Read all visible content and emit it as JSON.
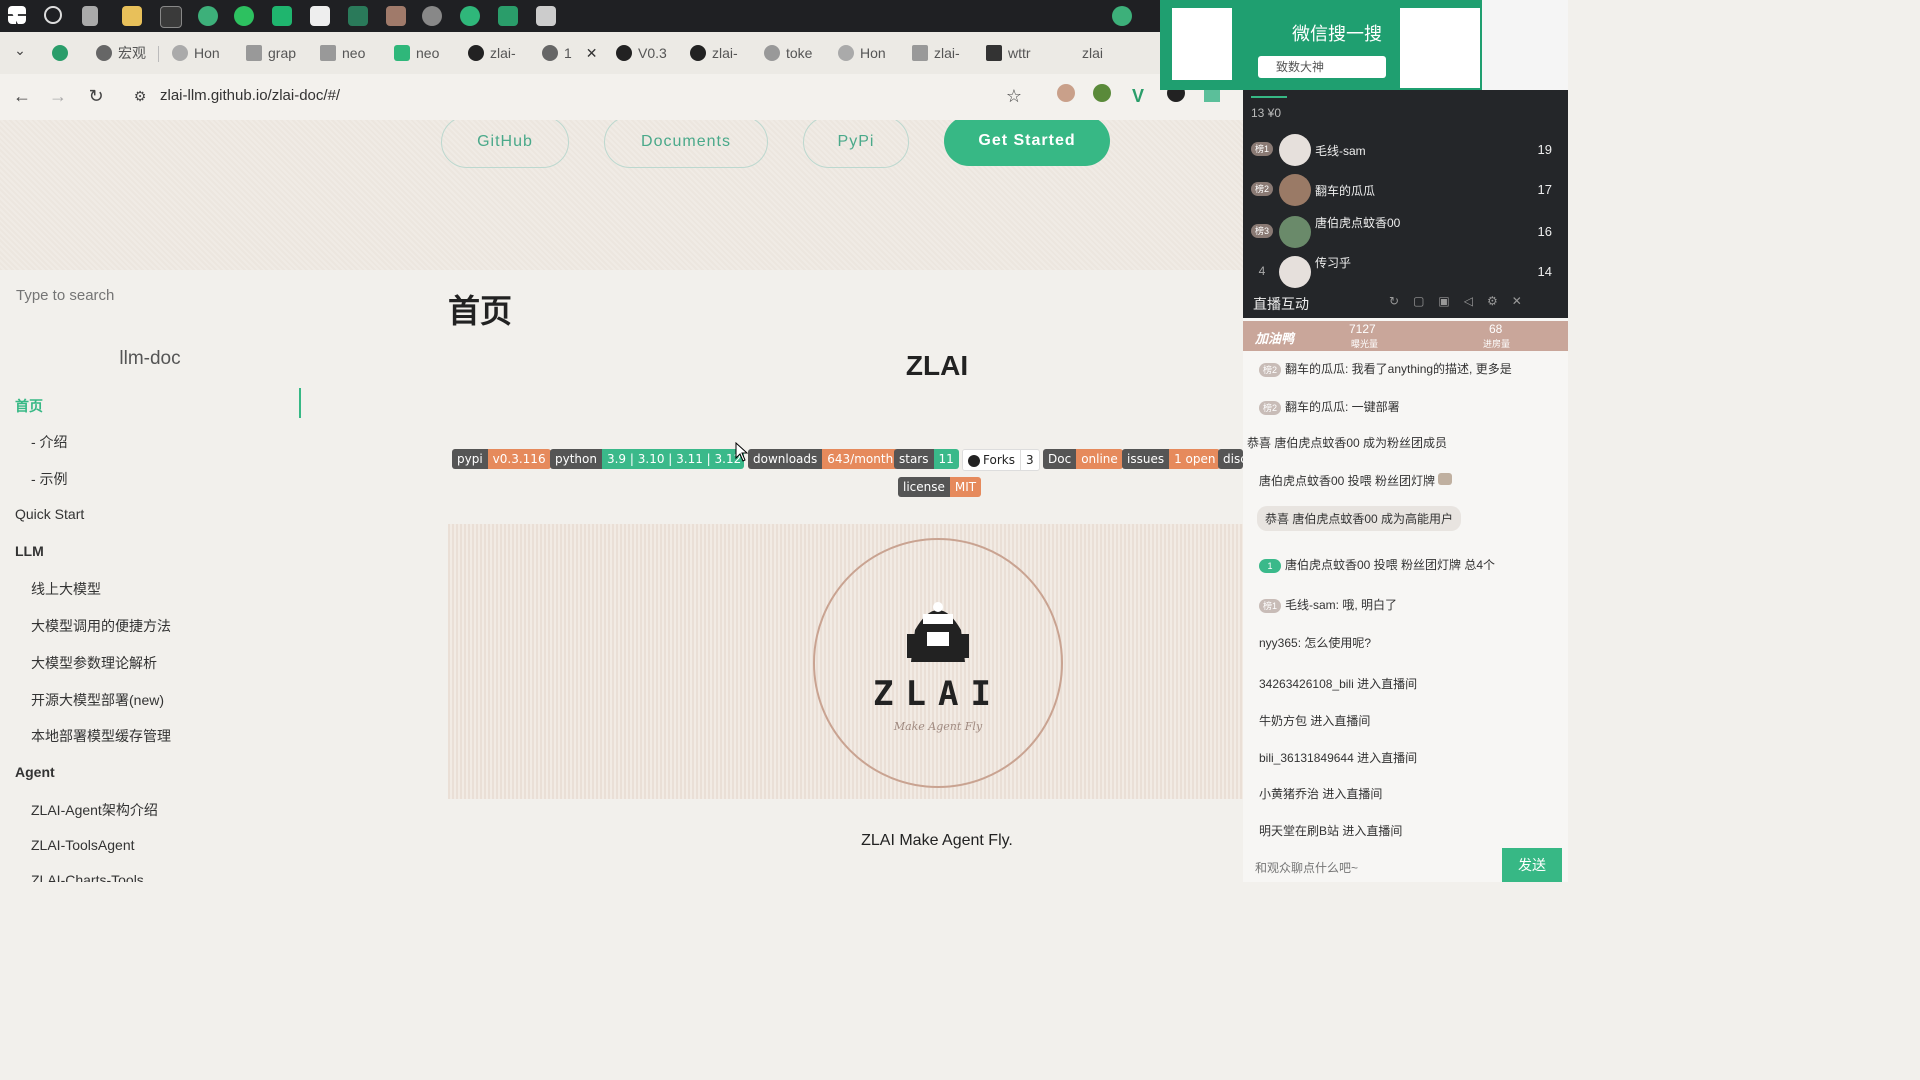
{
  "browser": {
    "tabs": [
      "宏观",
      "Hon",
      "grap",
      "neo",
      "neo",
      "zlai-",
      "1",
      "V0.3",
      "zlai-",
      "toke",
      "Hon",
      "zlai-",
      "wttr",
      "zlai"
    ],
    "url": "zlai-llm.github.io/zlai-doc/#/"
  },
  "hero": {
    "github": "GitHub",
    "documents": "Documents",
    "pypi": "PyPi",
    "start": "Get Started"
  },
  "sidebar": {
    "search_placeholder": "Type to search",
    "title": "llm-doc",
    "items": [
      {
        "label": "首页"
      },
      {
        "label": "- 介绍"
      },
      {
        "label": "- 示例"
      },
      {
        "label": "Quick Start"
      },
      {
        "label": "LLM"
      },
      {
        "label": "线上大模型"
      },
      {
        "label": "大模型调用的便捷方法"
      },
      {
        "label": "大模型参数理论解析"
      },
      {
        "label": "开源大模型部署(new)"
      },
      {
        "label": "本地部署模型缓存管理"
      },
      {
        "label": "Agent"
      },
      {
        "label": "ZLAI-Agent架构介绍"
      },
      {
        "label": "ZLAI-ToolsAgent"
      },
      {
        "label": "ZLAI-Charts-Tools"
      }
    ]
  },
  "content": {
    "heading": "首页",
    "title": "ZLAI",
    "badges": [
      {
        "l": "pypi",
        "r": "v0.3.116",
        "c": "#e68a5c"
      },
      {
        "l": "python",
        "r": "3.9 | 3.10 | 3.11 | 3.12",
        "c": "#3ab98a"
      },
      {
        "l": "downloads",
        "r": "643/month",
        "c": "#e68a5c"
      },
      {
        "l": "stars",
        "r": "11",
        "c": "#3ab98a"
      },
      {
        "l": "Forks",
        "r": "3",
        "c": "#ffffff"
      },
      {
        "l": "Doc",
        "r": "online",
        "c": "#e68a5c"
      },
      {
        "l": "issues",
        "r": "1 open",
        "c": "#e68a5c"
      },
      {
        "l": "disc",
        "r": "",
        "c": "#555555"
      },
      {
        "l": "license",
        "r": "MIT",
        "c": "#e68a5c"
      }
    ],
    "logo_text": "ZLAI",
    "logo_sub": "Make Agent Fly",
    "caption": "ZLAI Make Agent Fly."
  },
  "ad": {
    "text": "微信搜一搜",
    "search": "致数大神"
  },
  "live": {
    "stats": "13 ¥0",
    "ranks": [
      {
        "badge": "榜1",
        "name": "毛线-sam",
        "score": "19"
      },
      {
        "badge": "榜2",
        "name": "翻车的瓜瓜",
        "score": "17"
      },
      {
        "badge": "榜3",
        "name": "唐伯虎点蚊香00",
        "score": "16"
      },
      {
        "badge": "4",
        "name": "传习乎",
        "score": "14"
      }
    ],
    "panel_title": "直播互动",
    "banner_name": "加油鸭",
    "banner_v1": "7127",
    "banner_l1": "曝光量",
    "banner_v2": "68",
    "banner_l2": "进房量",
    "chats": [
      {
        "b": "榜2",
        "t": "翻车的瓜瓜: 我看了anything的描述, 更多是"
      },
      {
        "b": "榜2",
        "t": "翻车的瓜瓜: 一键部署"
      },
      {
        "b": "",
        "t": "恭喜 唐伯虎点蚊香00 成为粉丝团成员"
      },
      {
        "b": "",
        "t": "唐伯虎点蚊香00 投喂 粉丝团灯牌"
      },
      {
        "b": "",
        "t": "恭喜 唐伯虎点蚊香00 成为高能用户"
      },
      {
        "b": "1",
        "t": "唐伯虎点蚊香00 投喂 粉丝团灯牌 总4个"
      },
      {
        "b": "榜1",
        "t": "毛线-sam: 哦, 明白了"
      },
      {
        "b": "",
        "t": "nyy365: 怎么使用呢?"
      },
      {
        "b": "",
        "t": "34263426108_bili 进入直播间"
      },
      {
        "b": "",
        "t": "牛奶方包 进入直播间"
      },
      {
        "b": "",
        "t": "bili_36131849644 进入直播间"
      },
      {
        "b": "",
        "t": "小黄猪乔治 进入直播间"
      },
      {
        "b": "",
        "t": "明天堂在刷B站 进入直播间"
      }
    ],
    "input_placeholder": "和观众聊点什么吧~",
    "send": "发送"
  }
}
